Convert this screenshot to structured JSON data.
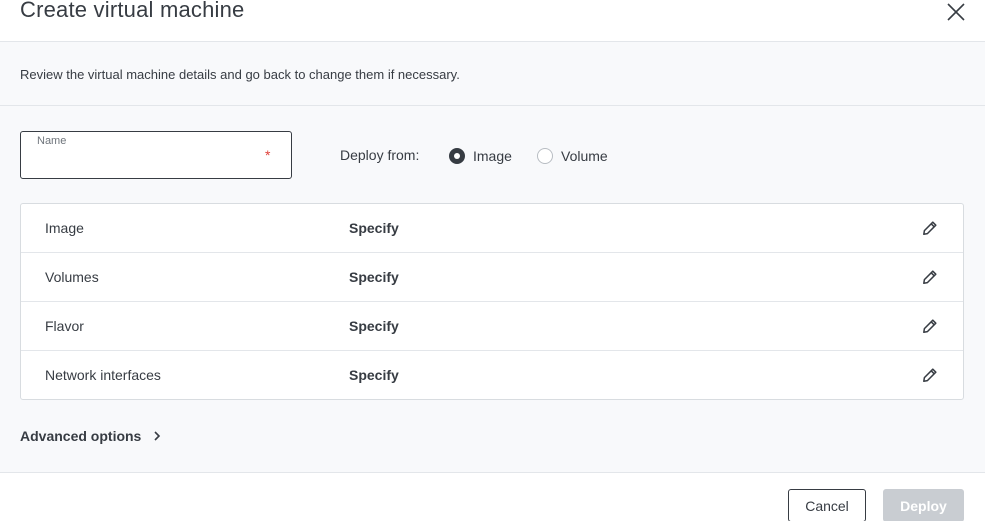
{
  "dialog": {
    "title": "Create virtual machine",
    "subtitle": "Review the virtual machine details and go back to change them if necessary."
  },
  "name_field": {
    "label": "Name",
    "value": "",
    "required_marker": "*"
  },
  "deploy_from": {
    "label": "Deploy from:",
    "options": [
      {
        "label": "Image",
        "checked": true
      },
      {
        "label": "Volume",
        "checked": false
      }
    ]
  },
  "details": {
    "rows": [
      {
        "label": "Image",
        "value": "Specify",
        "icon": "pencil-icon"
      },
      {
        "label": "Volumes",
        "value": "Specify",
        "icon": "pencil-icon"
      },
      {
        "label": "Flavor",
        "value": "Specify",
        "icon": "pencil-icon"
      },
      {
        "label": "Network interfaces",
        "value": "Specify",
        "icon": "pencil-icon"
      }
    ]
  },
  "advanced": {
    "label": "Advanced options",
    "icon": "chevron-right-icon"
  },
  "footer": {
    "cancel_label": "Cancel",
    "deploy_label": "Deploy",
    "deploy_disabled": true
  },
  "colors": {
    "text": "#373c43",
    "required": "#e0413a",
    "body_background": "#f8f9fb",
    "disabled_button": "#c9cdd2"
  }
}
